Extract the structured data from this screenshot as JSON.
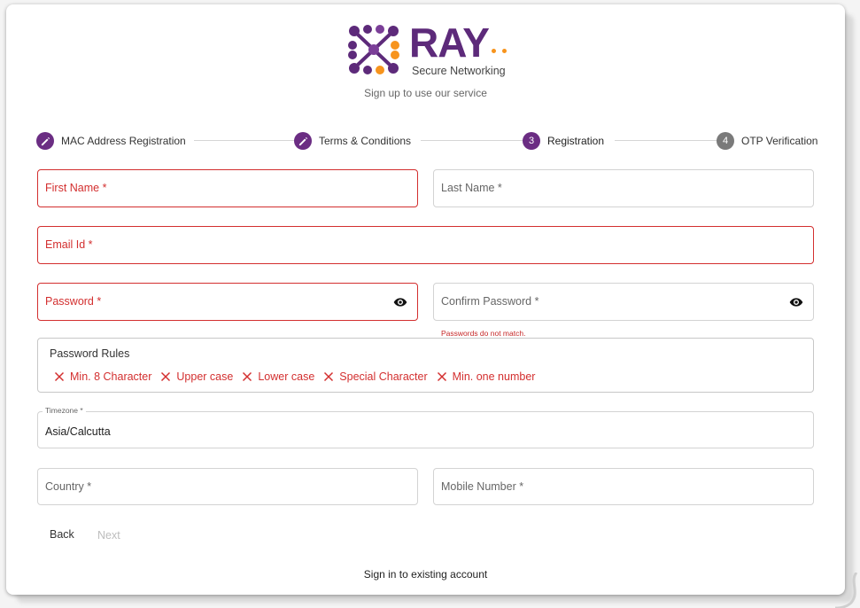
{
  "brand": {
    "name": "RAY",
    "tagline": "Secure Networking",
    "colors": {
      "purple": "#5d2a7a",
      "orange": "#f7941d",
      "error": "#d32f2f"
    }
  },
  "subtitle": "Sign up to use our service",
  "stepper": {
    "steps": [
      {
        "label": "MAC Address Registration",
        "icon": "pencil-icon",
        "state": "completed"
      },
      {
        "label": "Terms & Conditions",
        "icon": "pencil-icon",
        "state": "completed"
      },
      {
        "label": "Registration",
        "number": "3",
        "state": "active"
      },
      {
        "label": "OTP Verification",
        "number": "4",
        "state": "inactive"
      }
    ]
  },
  "form": {
    "first_name": {
      "label": "First Name *",
      "error": true
    },
    "last_name": {
      "label": "Last Name *",
      "error": false
    },
    "email": {
      "label": "Email Id *",
      "error": true
    },
    "password": {
      "label": "Password *",
      "error": true,
      "icon": "eye-icon"
    },
    "confirm_password": {
      "label": "Confirm Password *",
      "error": false,
      "icon": "eye-icon",
      "error_message": "Passwords do not match."
    },
    "timezone": {
      "label": "Timezone *",
      "value": "Asia/Calcutta"
    },
    "country": {
      "label": "Country *"
    },
    "mobile": {
      "label": "Mobile Number *"
    }
  },
  "password_rules": {
    "title": "Password Rules",
    "items": [
      "Min. 8 Character",
      "Upper case",
      "Lower case",
      "Special Character",
      "Min. one number"
    ]
  },
  "actions": {
    "back": "Back",
    "next": "Next"
  },
  "signin_link": "Sign in to existing account"
}
